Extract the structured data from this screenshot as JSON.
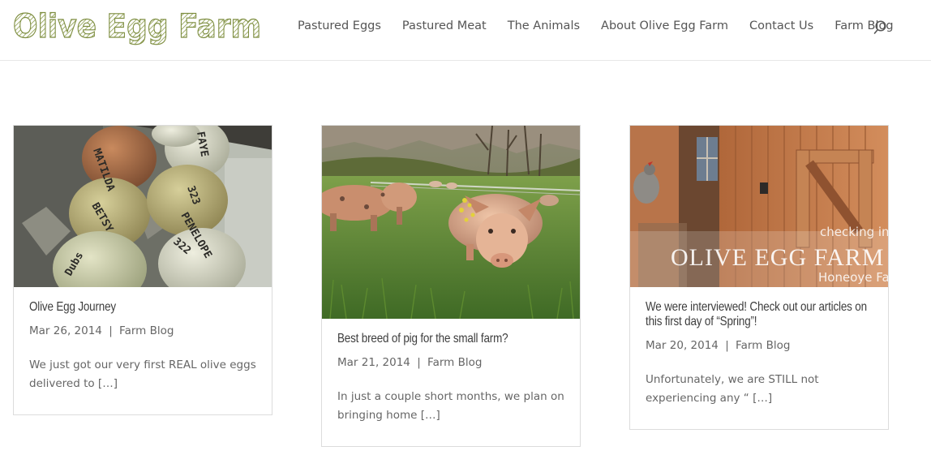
{
  "site": {
    "logo_text": "Olive Egg Farm"
  },
  "nav": {
    "items": [
      {
        "label": "Pastured Eggs",
        "name": "nav-pastured-eggs"
      },
      {
        "label": "Pastured Meat",
        "name": "nav-pastured-meat"
      },
      {
        "label": "The Animals",
        "name": "nav-the-animals"
      },
      {
        "label": "About Olive Egg Farm",
        "name": "nav-about"
      },
      {
        "label": "Contact Us",
        "name": "nav-contact"
      },
      {
        "label": "Farm Blog",
        "name": "nav-farm-blog"
      }
    ],
    "search_icon": "search-icon"
  },
  "posts": [
    {
      "title": "Olive Egg Journey",
      "date": "Mar 26, 2014",
      "separator": "|",
      "category": "Farm Blog",
      "excerpt": "We just got our very first REAL olive eggs delivered to […]"
    },
    {
      "title": "Best breed of pig for the small farm?",
      "date": "Mar 21, 2014",
      "separator": "|",
      "category": "Farm Blog",
      "excerpt": "In just a couple short months, we plan on bringing home […]"
    },
    {
      "title": "We were interviewed! Check out our articles on this first day of “Spring”!",
      "date": "Mar 20, 2014",
      "separator": "|",
      "category": "Farm Blog",
      "excerpt": "Unfortunately, we are STILL not experiencing any “ […]"
    }
  ],
  "image_text": {
    "coop_line1": "checking in w",
    "coop_line2": "OLIVE EGG FARM",
    "coop_line3": "Honeoye Falls",
    "egg_labels": [
      "MATILDA",
      "FAYE",
      "323",
      "BETSY",
      "PENELOPE",
      "322",
      "Dubs"
    ]
  },
  "colors": {
    "logo_green": "#8a9a4a",
    "text": "#666666",
    "title": "#3d3d3d",
    "border": "#dcdcdc"
  }
}
